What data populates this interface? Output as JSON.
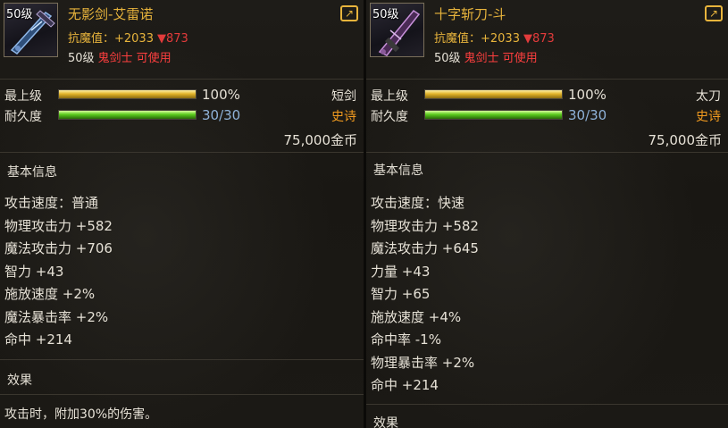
{
  "items": [
    {
      "level_badge": "50级",
      "name": "无影剑-艾雷诺",
      "resist_label": "抗魔值：+2033",
      "resist_down": "▼873",
      "req_level": "50级",
      "req_class": "鬼剑士 可使用",
      "grade_label": "最上级",
      "grade_value": "100%",
      "grade_fill": 1.0,
      "weapon_type": "短剑",
      "durability_label": "耐久度",
      "durability_value": "30/30",
      "durability_fill": 1.0,
      "rarity": "史诗",
      "price": "75,000金币",
      "section_basic": "基本信息",
      "stats": [
        "攻击速度：普通",
        "物理攻击力 +582",
        "魔法攻击力 +706",
        "智力 +43",
        "施放速度 +2%",
        "魔法暴击率 +2%",
        "命中 +214"
      ],
      "section_effect": "效果",
      "effect_text": "攻击时，附加30%的伤害。"
    },
    {
      "level_badge": "50级",
      "name": "十字斩刀-斗",
      "resist_label": "抗魔值：+2033",
      "resist_down": "▼873",
      "req_level": "50级",
      "req_class": "鬼剑士 可使用",
      "grade_label": "最上级",
      "grade_value": "100%",
      "grade_fill": 1.0,
      "weapon_type": "太刀",
      "durability_label": "耐久度",
      "durability_value": "30/30",
      "durability_fill": 1.0,
      "rarity": "史诗",
      "price": "75,000金币",
      "section_basic": "基本信息",
      "stats": [
        "攻击速度：快速",
        "物理攻击力 +582",
        "魔法攻击力 +645",
        "力量 +43",
        "智力 +65",
        "施放速度 +4%",
        "命中率 -1%",
        "物理暴击率 +2%",
        "命中 +214"
      ],
      "section_effect": "效果"
    }
  ],
  "icons": {
    "share": "share-arrow-icon",
    "weapon_1": "dagger-icon",
    "weapon_2": "katana-icon"
  },
  "colors": {
    "name": "#e8b43c",
    "class_red": "#ff3f3f",
    "epic": "#f29b1f",
    "durability": "#8fb2d8"
  }
}
